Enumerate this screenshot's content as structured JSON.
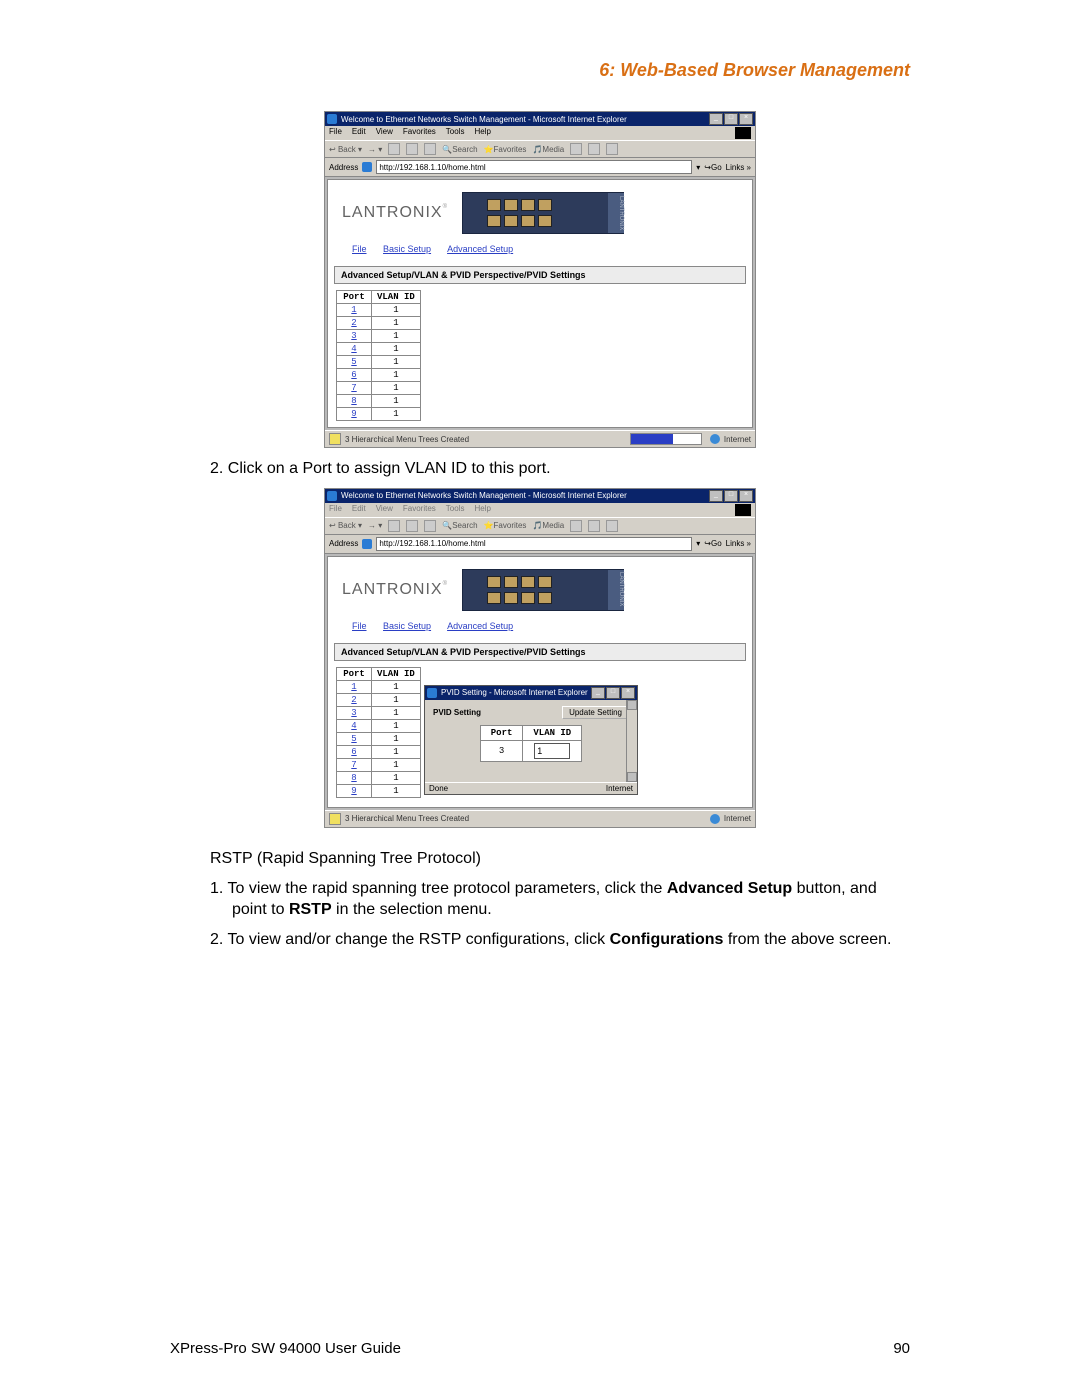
{
  "chapter": "6: Web-Based Browser Management",
  "ie": {
    "title": "Welcome to Ethernet Networks Switch Management - Microsoft Internet Explorer",
    "menus": [
      "File",
      "Edit",
      "View",
      "Favorites",
      "Tools",
      "Help"
    ],
    "toolbar": {
      "back": "Back",
      "search": "Search",
      "favorites": "Favorites",
      "media": "Media"
    },
    "address_label": "Address",
    "address_value": "http://192.168.1.10/home.html",
    "go": "Go",
    "links": "Links »",
    "status_text": "3 Hierarchical Menu Trees Created",
    "zone": "Internet"
  },
  "lantronix": {
    "name": "LANTRONIX",
    "switch_label": "LANTRONIX",
    "nav": {
      "file": "File",
      "basic": "Basic Setup",
      "advanced": "Advanced Setup"
    },
    "section_heading": "Advanced Setup/VLAN & PVID Perspective/PVID Settings",
    "table": {
      "headers": [
        "Port",
        "VLAN ID"
      ],
      "rows": [
        {
          "port": "1",
          "vlan": "1"
        },
        {
          "port": "2",
          "vlan": "1"
        },
        {
          "port": "3",
          "vlan": "1"
        },
        {
          "port": "4",
          "vlan": "1"
        },
        {
          "port": "5",
          "vlan": "1"
        },
        {
          "port": "6",
          "vlan": "1"
        },
        {
          "port": "7",
          "vlan": "1"
        },
        {
          "port": "8",
          "vlan": "1"
        },
        {
          "port": "9",
          "vlan": "1"
        }
      ]
    }
  },
  "popup": {
    "title": "PVID Setting - Microsoft Internet Explorer",
    "heading": "PVID Setting",
    "update_btn": "Update Setting",
    "port_label": "Port",
    "vlan_label": "VLAN ID",
    "port_value": "3",
    "vlan_value": "1",
    "done": "Done",
    "zone": "Internet"
  },
  "text": {
    "step2a": "2.  Click on a Port to assign VLAN ID to this port.",
    "rstp_heading": "RSTP (Rapid Spanning Tree Protocol)",
    "step1_pre": "1.  To view the rapid spanning tree protocol parameters, click the ",
    "adv_setup": "Advanced Setup",
    "step1_mid": " button, and point to ",
    "rstp_bold": "RSTP",
    "step1_post": " in the selection menu.",
    "step2b_pre": "2.  To view and/or change the RSTP configurations, click ",
    "config_bold": "Configurations",
    "step2b_post": " from the above screen."
  },
  "footer": {
    "left": "XPress-Pro SW 94000 User Guide",
    "right": "90"
  }
}
